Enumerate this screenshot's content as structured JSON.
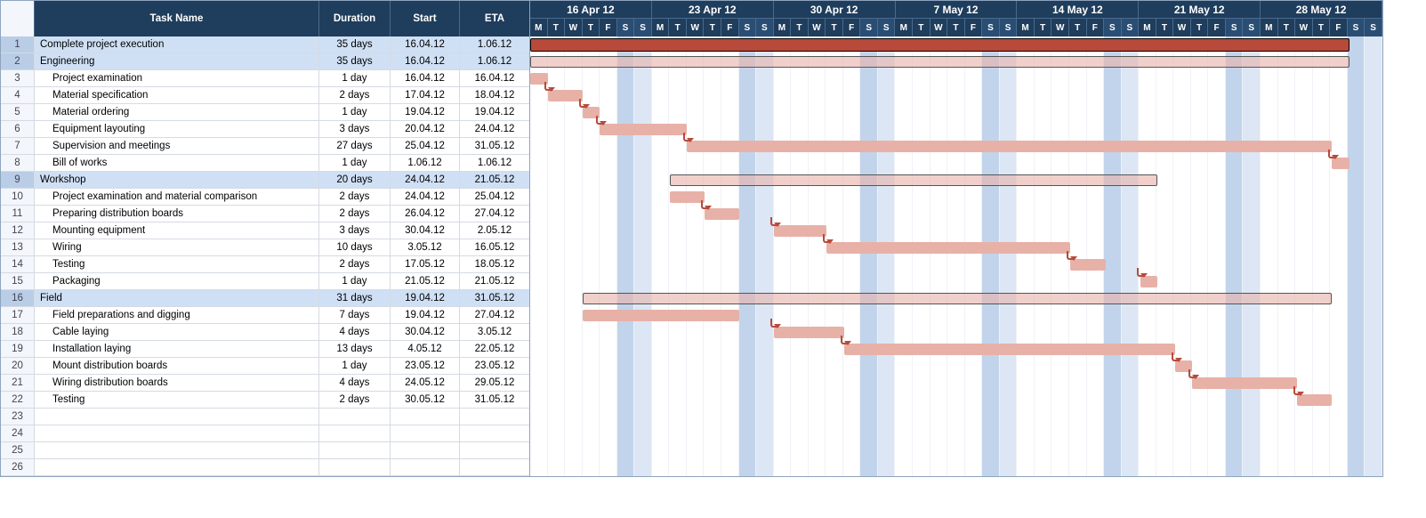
{
  "columns": {
    "task_name": "Task Name",
    "duration": "Duration",
    "start": "Start",
    "eta": "ETA"
  },
  "timeline": {
    "start_day_index": 0,
    "day_letters": [
      "M",
      "T",
      "W",
      "T",
      "F",
      "S",
      "S"
    ],
    "weeks": [
      {
        "label": "16 Apr 12"
      },
      {
        "label": "23 Apr 12"
      },
      {
        "label": "30 Apr 12"
      },
      {
        "label": "7 May 12"
      },
      {
        "label": "14 May 12"
      },
      {
        "label": "21 May 12"
      },
      {
        "label": "28 May 12"
      }
    ]
  },
  "tasks": [
    {
      "id": 1,
      "name": "Complete project execution",
      "duration": "35 days",
      "start": "16.04.12",
      "eta": "1.06.12",
      "indent": 0,
      "type": "summary-top",
      "bar_start": 0,
      "bar_len": 47
    },
    {
      "id": 2,
      "name": "Engineering",
      "duration": "35 days",
      "start": "16.04.12",
      "eta": "1.06.12",
      "indent": 0,
      "type": "summary",
      "bar_start": 0,
      "bar_len": 47
    },
    {
      "id": 3,
      "name": "Project examination",
      "duration": "1 day",
      "start": "16.04.12",
      "eta": "16.04.12",
      "indent": 1,
      "type": "task",
      "bar_start": 0,
      "bar_len": 1,
      "link_from_prev": false
    },
    {
      "id": 4,
      "name": "Material specification",
      "duration": "2 days",
      "start": "17.04.12",
      "eta": "18.04.12",
      "indent": 1,
      "type": "task",
      "bar_start": 1,
      "bar_len": 2,
      "link_from_prev": true
    },
    {
      "id": 5,
      "name": "Material ordering",
      "duration": "1 day",
      "start": "19.04.12",
      "eta": "19.04.12",
      "indent": 1,
      "type": "task",
      "bar_start": 3,
      "bar_len": 1,
      "link_from_prev": true
    },
    {
      "id": 6,
      "name": "Equipment layouting",
      "duration": "3 days",
      "start": "20.04.12",
      "eta": "24.04.12",
      "indent": 1,
      "type": "task",
      "bar_start": 4,
      "bar_len": 5,
      "link_from_prev": true
    },
    {
      "id": 7,
      "name": "Supervision and meetings",
      "duration": "27 days",
      "start": "25.04.12",
      "eta": "31.05.12",
      "indent": 1,
      "type": "task",
      "bar_start": 9,
      "bar_len": 37,
      "link_from_prev": true
    },
    {
      "id": 8,
      "name": "Bill of works",
      "duration": "1 day",
      "start": "1.06.12",
      "eta": "1.06.12",
      "indent": 1,
      "type": "task",
      "bar_start": 46,
      "bar_len": 1,
      "link_from_prev": true
    },
    {
      "id": 9,
      "name": "Workshop",
      "duration": "20 days",
      "start": "24.04.12",
      "eta": "21.05.12",
      "indent": 0,
      "type": "summary",
      "bar_start": 8,
      "bar_len": 28
    },
    {
      "id": 10,
      "name": "Project examination and material comparison",
      "duration": "2 days",
      "start": "24.04.12",
      "eta": "25.04.12",
      "indent": 1,
      "type": "task",
      "bar_start": 8,
      "bar_len": 2,
      "link_from_prev": false
    },
    {
      "id": 11,
      "name": "Preparing distribution boards",
      "duration": "2 days",
      "start": "26.04.12",
      "eta": "27.04.12",
      "indent": 1,
      "type": "task",
      "bar_start": 10,
      "bar_len": 2,
      "link_from_prev": true
    },
    {
      "id": 12,
      "name": "Mounting equipment",
      "duration": "3 days",
      "start": "30.04.12",
      "eta": "2.05.12",
      "indent": 1,
      "type": "task",
      "bar_start": 14,
      "bar_len": 3,
      "link_from_prev": true
    },
    {
      "id": 13,
      "name": "Wiring",
      "duration": "10 days",
      "start": "3.05.12",
      "eta": "16.05.12",
      "indent": 1,
      "type": "task",
      "bar_start": 17,
      "bar_len": 14,
      "link_from_prev": true
    },
    {
      "id": 14,
      "name": "Testing",
      "duration": "2 days",
      "start": "17.05.12",
      "eta": "18.05.12",
      "indent": 1,
      "type": "task",
      "bar_start": 31,
      "bar_len": 2,
      "link_from_prev": true
    },
    {
      "id": 15,
      "name": "Packaging",
      "duration": "1 day",
      "start": "21.05.12",
      "eta": "21.05.12",
      "indent": 1,
      "type": "task",
      "bar_start": 35,
      "bar_len": 1,
      "link_from_prev": true
    },
    {
      "id": 16,
      "name": "Field",
      "duration": "31 days",
      "start": "19.04.12",
      "eta": "31.05.12",
      "indent": 0,
      "type": "summary",
      "bar_start": 3,
      "bar_len": 43
    },
    {
      "id": 17,
      "name": "Field preparations and digging",
      "duration": "7 days",
      "start": "19.04.12",
      "eta": "27.04.12",
      "indent": 1,
      "type": "task",
      "bar_start": 3,
      "bar_len": 9,
      "link_from_prev": false
    },
    {
      "id": 18,
      "name": "Cable laying",
      "duration": "4 days",
      "start": "30.04.12",
      "eta": "3.05.12",
      "indent": 1,
      "type": "task",
      "bar_start": 14,
      "bar_len": 4,
      "link_from_prev": true
    },
    {
      "id": 19,
      "name": "Installation laying",
      "duration": "13 days",
      "start": "4.05.12",
      "eta": "22.05.12",
      "indent": 1,
      "type": "task",
      "bar_start": 18,
      "bar_len": 19,
      "link_from_prev": true
    },
    {
      "id": 20,
      "name": "Mount distribution boards",
      "duration": "1 day",
      "start": "23.05.12",
      "eta": "23.05.12",
      "indent": 1,
      "type": "task",
      "bar_start": 37,
      "bar_len": 1,
      "link_from_prev": true
    },
    {
      "id": 21,
      "name": "Wiring distribution boards",
      "duration": "4 days",
      "start": "24.05.12",
      "eta": "29.05.12",
      "indent": 1,
      "type": "task",
      "bar_start": 38,
      "bar_len": 6,
      "link_from_prev": true
    },
    {
      "id": 22,
      "name": "Testing",
      "duration": "2 days",
      "start": "30.05.12",
      "eta": "31.05.12",
      "indent": 1,
      "type": "task",
      "bar_start": 44,
      "bar_len": 2,
      "link_from_prev": true
    }
  ],
  "empty_rows": 4,
  "chart_data": {
    "type": "gantt",
    "title": "",
    "date_axis_start": "2012-04-16",
    "date_axis_end": "2012-06-03",
    "tasks": [
      {
        "id": 1,
        "name": "Complete project execution",
        "start": "2012-04-16",
        "end": "2012-06-01",
        "duration_days": 35,
        "summary": true,
        "parent": null
      },
      {
        "id": 2,
        "name": "Engineering",
        "start": "2012-04-16",
        "end": "2012-06-01",
        "duration_days": 35,
        "summary": true,
        "parent": 1
      },
      {
        "id": 3,
        "name": "Project examination",
        "start": "2012-04-16",
        "end": "2012-04-16",
        "duration_days": 1,
        "summary": false,
        "parent": 2,
        "depends_on": null
      },
      {
        "id": 4,
        "name": "Material specification",
        "start": "2012-04-17",
        "end": "2012-04-18",
        "duration_days": 2,
        "summary": false,
        "parent": 2,
        "depends_on": 3
      },
      {
        "id": 5,
        "name": "Material ordering",
        "start": "2012-04-19",
        "end": "2012-04-19",
        "duration_days": 1,
        "summary": false,
        "parent": 2,
        "depends_on": 4
      },
      {
        "id": 6,
        "name": "Equipment layouting",
        "start": "2012-04-20",
        "end": "2012-04-24",
        "duration_days": 3,
        "summary": false,
        "parent": 2,
        "depends_on": 5
      },
      {
        "id": 7,
        "name": "Supervision and meetings",
        "start": "2012-04-25",
        "end": "2012-05-31",
        "duration_days": 27,
        "summary": false,
        "parent": 2,
        "depends_on": 6
      },
      {
        "id": 8,
        "name": "Bill of works",
        "start": "2012-06-01",
        "end": "2012-06-01",
        "duration_days": 1,
        "summary": false,
        "parent": 2,
        "depends_on": 7
      },
      {
        "id": 9,
        "name": "Workshop",
        "start": "2012-04-24",
        "end": "2012-05-21",
        "duration_days": 20,
        "summary": true,
        "parent": 1
      },
      {
        "id": 10,
        "name": "Project examination and material comparison",
        "start": "2012-04-24",
        "end": "2012-04-25",
        "duration_days": 2,
        "summary": false,
        "parent": 9,
        "depends_on": null
      },
      {
        "id": 11,
        "name": "Preparing distribution boards",
        "start": "2012-04-26",
        "end": "2012-04-27",
        "duration_days": 2,
        "summary": false,
        "parent": 9,
        "depends_on": 10
      },
      {
        "id": 12,
        "name": "Mounting equipment",
        "start": "2012-04-30",
        "end": "2012-05-02",
        "duration_days": 3,
        "summary": false,
        "parent": 9,
        "depends_on": 11
      },
      {
        "id": 13,
        "name": "Wiring",
        "start": "2012-05-03",
        "end": "2012-05-16",
        "duration_days": 10,
        "summary": false,
        "parent": 9,
        "depends_on": 12
      },
      {
        "id": 14,
        "name": "Testing",
        "start": "2012-05-17",
        "end": "2012-05-18",
        "duration_days": 2,
        "summary": false,
        "parent": 9,
        "depends_on": 13
      },
      {
        "id": 15,
        "name": "Packaging",
        "start": "2012-05-21",
        "end": "2012-05-21",
        "duration_days": 1,
        "summary": false,
        "parent": 9,
        "depends_on": 14
      },
      {
        "id": 16,
        "name": "Field",
        "start": "2012-04-19",
        "end": "2012-05-31",
        "duration_days": 31,
        "summary": true,
        "parent": 1
      },
      {
        "id": 17,
        "name": "Field preparations and digging",
        "start": "2012-04-19",
        "end": "2012-04-27",
        "duration_days": 7,
        "summary": false,
        "parent": 16,
        "depends_on": null
      },
      {
        "id": 18,
        "name": "Cable laying",
        "start": "2012-04-30",
        "end": "2012-05-03",
        "duration_days": 4,
        "summary": false,
        "parent": 16,
        "depends_on": 17
      },
      {
        "id": 19,
        "name": "Installation laying",
        "start": "2012-05-04",
        "end": "2012-05-22",
        "duration_days": 13,
        "summary": false,
        "parent": 16,
        "depends_on": 18
      },
      {
        "id": 20,
        "name": "Mount distribution boards",
        "start": "2012-05-23",
        "end": "2012-05-23",
        "duration_days": 1,
        "summary": false,
        "parent": 16,
        "depends_on": 19
      },
      {
        "id": 21,
        "name": "Wiring distribution boards",
        "start": "2012-05-24",
        "end": "2012-05-29",
        "duration_days": 4,
        "summary": false,
        "parent": 16,
        "depends_on": 20
      },
      {
        "id": 22,
        "name": "Testing",
        "start": "2012-05-30",
        "end": "2012-05-31",
        "duration_days": 2,
        "summary": false,
        "parent": 16,
        "depends_on": 21
      }
    ]
  }
}
